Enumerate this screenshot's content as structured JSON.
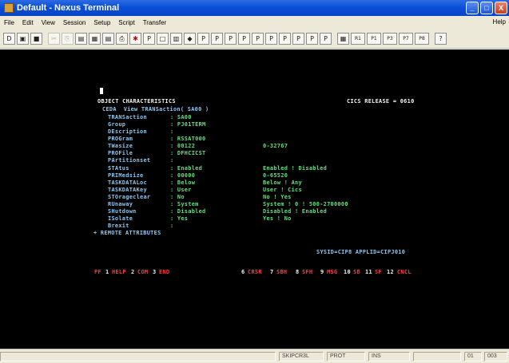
{
  "window": {
    "title": "Default - Nexus Terminal",
    "buttons": [
      "_",
      "□",
      "X"
    ]
  },
  "menu": {
    "items": [
      "File",
      "Edit",
      "View",
      "Session",
      "Setup",
      "Script",
      "Transfer"
    ],
    "help": "Help"
  },
  "toolbar": {
    "buttons": [
      "D",
      "▣",
      "■",
      "✂",
      "⎘",
      "▤",
      "▦",
      "▤",
      "⎙",
      "✱",
      "P",
      "□",
      "▥",
      "◆",
      "P",
      "P",
      "P",
      "P",
      "P",
      "P",
      "P",
      "P",
      "P",
      "P",
      "▦",
      "R1",
      "P1",
      "P3",
      "P7",
      "P8",
      "?"
    ]
  },
  "terminal": {
    "heading": "OBJECT CHARACTERISTICS",
    "release": "CICS RELEASE = 0610",
    "command": "CEDA  View TRANSaction( SA00 )",
    "fields": [
      {
        "name": "TRANSaction",
        "value": ": SA00",
        "range": ""
      },
      {
        "name": "Group",
        "value": ": PJ01TERM",
        "range": ""
      },
      {
        "name": "DEscription",
        "value": ":",
        "range": ""
      },
      {
        "name": "PROGram",
        "value": ": RSSAT000",
        "range": ""
      },
      {
        "name": "TWasize",
        "value": ": 00122",
        "range": "0-32767"
      },
      {
        "name": "PROFile",
        "value": ": DFHCICST",
        "range": ""
      },
      {
        "name": "PArtitionset",
        "value": ":",
        "range": ""
      },
      {
        "name": "STAtus",
        "value": ": Enabled",
        "range": "Enabled ! Disabled"
      },
      {
        "name": "PRIMedsize",
        "value": ": 00000",
        "range": "0-65520"
      },
      {
        "name": "TASKDATALoc",
        "value": ": Below",
        "range": "Below ! Any"
      },
      {
        "name": "TASKDATAKey",
        "value": ": User",
        "range": "User ! Cics"
      },
      {
        "name": "STOrageclear",
        "value": ": No",
        "range": "No ! Yes"
      },
      {
        "name": "RUnaway",
        "value": ": System",
        "range": "System ! 0 ! 500-2700000"
      },
      {
        "name": "SHutdown",
        "value": ": Disabled",
        "range": "Disabled ! Enabled"
      },
      {
        "name": "ISolate",
        "value": ": Yes",
        "range": "Yes ! No"
      },
      {
        "name": "Brexit",
        "value": ":",
        "range": ""
      }
    ],
    "remote": "+ REMOTE ATTRIBUTES",
    "sysid": "SYSID=CIP8 APPLID=CIPJ010",
    "pf_keys_left": [
      {
        "key": "PF",
        "label": ""
      },
      {
        "key": "1",
        "label": "HELP"
      },
      {
        "key": "2",
        "label": "COM"
      },
      {
        "key": "3",
        "label": "END"
      }
    ],
    "pf_keys_right": [
      {
        "key": "6",
        "label": "CRSR"
      },
      {
        "key": "7",
        "label": "SBH"
      },
      {
        "key": "8",
        "label": "SFH"
      },
      {
        "key": "9",
        "label": "MSG"
      },
      {
        "key": "10",
        "label": "SB"
      },
      {
        "key": "11",
        "label": "SF"
      },
      {
        "key": "12",
        "label": "CNCL"
      }
    ]
  },
  "status": {
    "cells": [
      "SKIPCR3L",
      "PROT",
      "INS",
      "01",
      "003"
    ]
  }
}
